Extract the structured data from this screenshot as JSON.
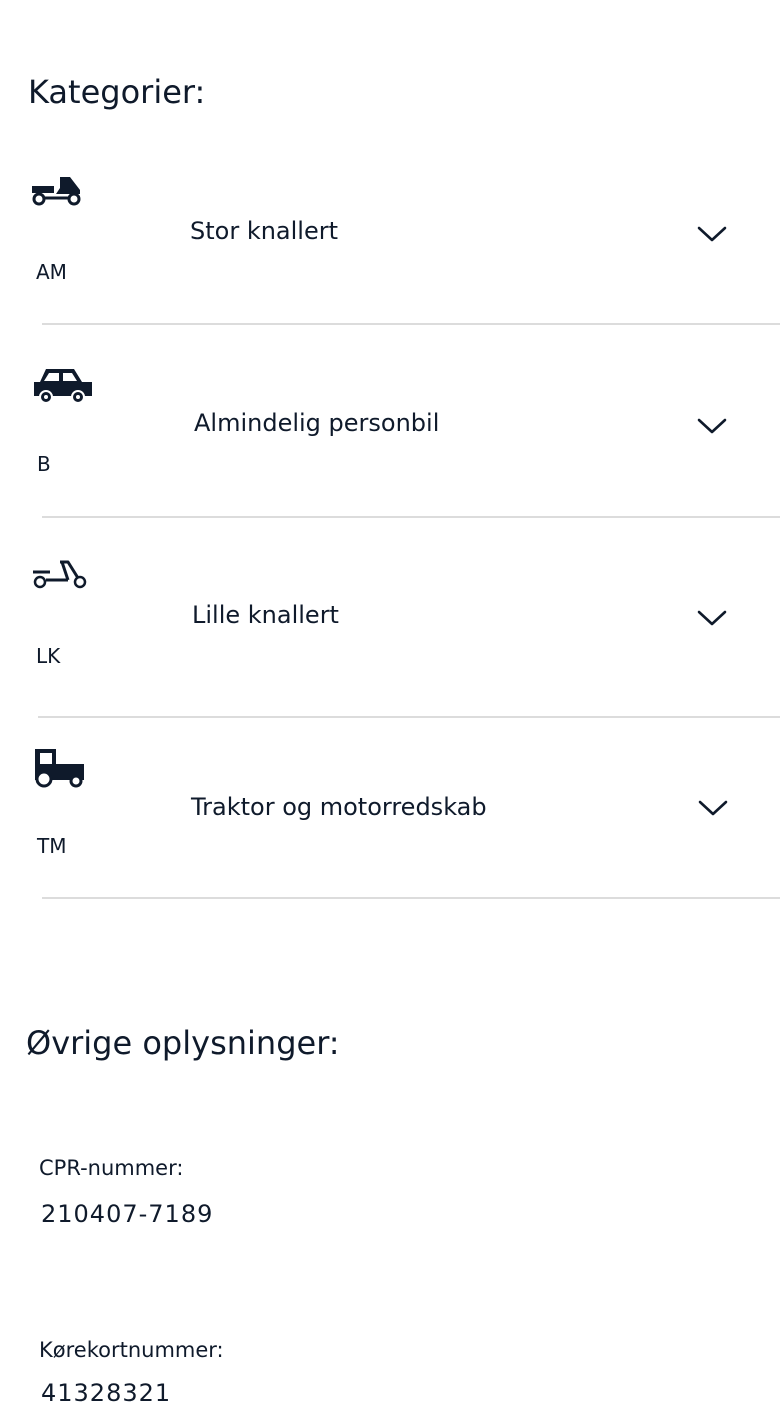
{
  "categories_title": "Kategorier:",
  "categories": [
    {
      "code": "AM",
      "name": "Stor knallert",
      "icon": "moped-large-icon"
    },
    {
      "code": "B",
      "name": "Almindelig personbil",
      "icon": "car-icon"
    },
    {
      "code": "LK",
      "name": "Lille knallert",
      "icon": "moped-small-icon"
    },
    {
      "code": "TM",
      "name": "Traktor og motorredskab",
      "icon": "tractor-icon"
    }
  ],
  "other_title": "Øvrige oplysninger:",
  "info": {
    "cpr_label": "CPR-nummer:",
    "cpr_value": "210407-7189",
    "license_label": "Kørekortnummer:",
    "license_value": "41328321"
  },
  "colors": {
    "text": "#0f1a2b",
    "divider": "#dcdcdc",
    "background": "#ffffff"
  }
}
